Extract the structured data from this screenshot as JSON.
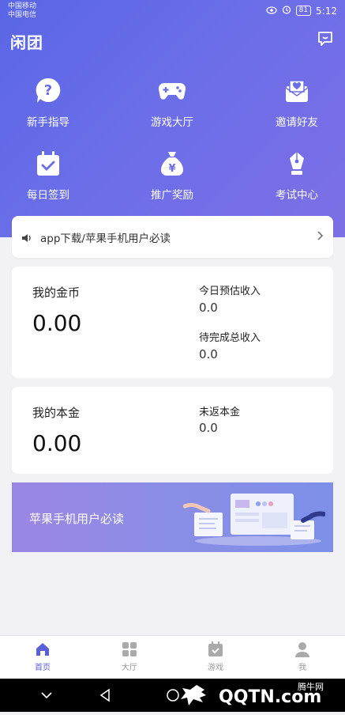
{
  "status": {
    "carrier1": "中国移动",
    "carrier2": "中国电信",
    "battery": "81",
    "time": "5:12"
  },
  "header": {
    "logo": "闲团",
    "chat_icon": "chat-icon"
  },
  "grid": [
    {
      "label": "新手指导",
      "icon": "question-icon"
    },
    {
      "label": "游戏大厅",
      "icon": "gamepad-icon"
    },
    {
      "label": "邀请好友",
      "icon": "invite-icon"
    },
    {
      "label": "每日签到",
      "icon": "calendar-check-icon"
    },
    {
      "label": "推广奖励",
      "icon": "moneybag-icon"
    },
    {
      "label": "考试中心",
      "icon": "pen-icon"
    }
  ],
  "notice": {
    "text": "app下载/苹果手机用户必读",
    "icon": "speaker-icon"
  },
  "coins": {
    "title": "我的金币",
    "value": "0.00",
    "today_label": "今日预估收入",
    "today_value": "0.0",
    "pending_label": "待完成总收入",
    "pending_value": "0.0"
  },
  "principal": {
    "title": "我的本金",
    "value": "0.00",
    "unreturned_label": "未返本金",
    "unreturned_value": "0.0"
  },
  "banner": {
    "text": "苹果手机用户必读"
  },
  "tabs": [
    {
      "label": "首页",
      "icon": "home-icon",
      "active": true
    },
    {
      "label": "大厅",
      "icon": "grid-icon",
      "active": false
    },
    {
      "label": "游戏",
      "icon": "game-check-icon",
      "active": false
    },
    {
      "label": "我",
      "icon": "user-icon",
      "active": false
    }
  ],
  "watermark": {
    "site": "QQTN.com",
    "brand": "腾牛网"
  },
  "colors": {
    "accent": "#5a5fd8",
    "hero_start": "#5a66e6",
    "hero_end": "#7d6fe6"
  }
}
